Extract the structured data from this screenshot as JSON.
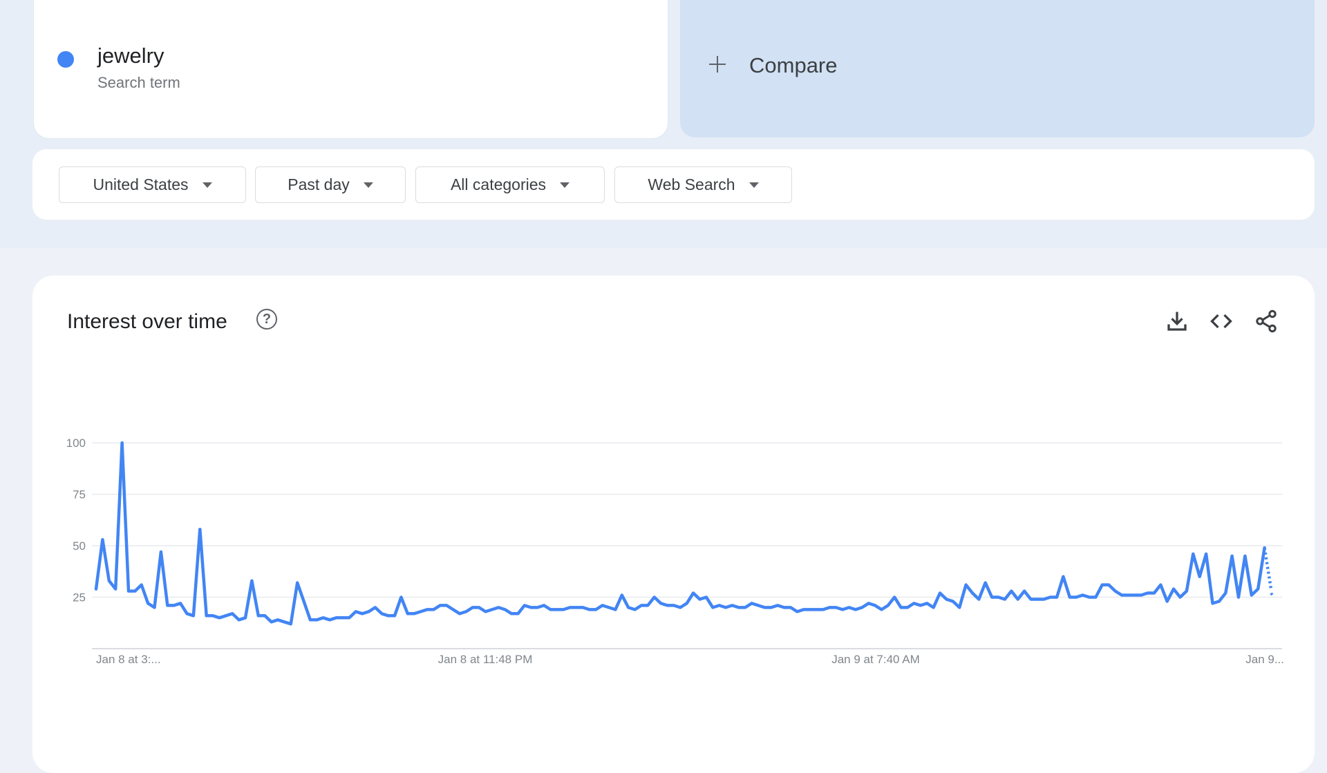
{
  "search_term": {
    "name": "jewelry",
    "subtitle": "Search term",
    "color": "#4285f4"
  },
  "compare": {
    "label": "Compare"
  },
  "filters": [
    {
      "label": "United States"
    },
    {
      "label": "Past day"
    },
    {
      "label": "All categories"
    },
    {
      "label": "Web Search"
    }
  ],
  "chart_section": {
    "title": "Interest over time",
    "icons": [
      "help-icon",
      "download-icon",
      "embed-icon",
      "share-icon"
    ]
  },
  "chart_data": {
    "type": "line",
    "title": "",
    "xlabel": "",
    "ylabel": "",
    "ylim": [
      0,
      100
    ],
    "yticks": [
      100,
      75,
      50,
      25
    ],
    "xtick_labels": [
      "Jan 8 at 3:...",
      "Jan 8 at 11:48 PM",
      "Jan 9 at 7:40 AM",
      "Jan 9..."
    ],
    "grid": true,
    "legend": "none",
    "series": [
      {
        "color": "#4285f4",
        "partial_last_points": 1,
        "values": [
          29,
          53,
          33,
          29,
          100,
          28,
          28,
          31,
          22,
          20,
          47,
          21,
          21,
          22,
          17,
          16,
          58,
          16,
          16,
          15,
          16,
          17,
          14,
          15,
          33,
          16,
          16,
          13,
          14,
          13,
          12,
          32,
          23,
          14,
          14,
          15,
          14,
          15,
          15,
          15,
          18,
          17,
          18,
          20,
          17,
          16,
          16,
          25,
          17,
          17,
          18,
          19,
          19,
          21,
          21,
          19,
          17,
          18,
          20,
          20,
          18,
          19,
          20,
          19,
          17,
          17,
          21,
          20,
          20,
          21,
          19,
          19,
          19,
          20,
          20,
          20,
          19,
          19,
          21,
          20,
          19,
          26,
          20,
          19,
          21,
          21,
          25,
          22,
          21,
          21,
          20,
          22,
          27,
          24,
          25,
          20,
          21,
          20,
          21,
          20,
          20,
          22,
          21,
          20,
          20,
          21,
          20,
          20,
          18,
          19,
          19,
          19,
          19,
          20,
          20,
          19,
          20,
          19,
          20,
          22,
          21,
          19,
          21,
          25,
          20,
          20,
          22,
          21,
          22,
          20,
          27,
          24,
          23,
          20,
          31,
          27,
          24,
          32,
          25,
          25,
          24,
          28,
          24,
          28,
          24,
          24,
          24,
          25,
          25,
          35,
          25,
          25,
          26,
          25,
          25,
          31,
          31,
          28,
          26,
          26,
          26,
          26,
          27,
          27,
          31,
          23,
          29,
          25,
          28,
          46,
          35,
          46,
          22,
          23,
          27,
          45,
          25,
          45,
          26,
          29,
          49,
          29
        ]
      }
    ]
  }
}
